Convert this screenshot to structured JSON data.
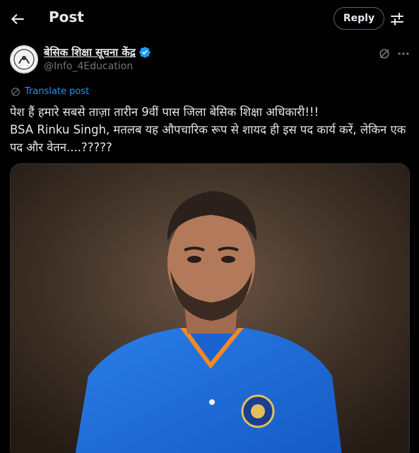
{
  "header": {
    "title": "Post",
    "reply_label": "Reply"
  },
  "post": {
    "author_name": "बेसिक शिक्षा सूचना केंद्र",
    "author_handle": "@Info_4Education",
    "translate_label": "Translate post",
    "text_line1": "पेश हैं हमारे सबसे ताज़ा तारीन 9वीं पास जिला बेसिक शिक्षा अधिकारी!!!",
    "text_line2": "BSA Rinku Singh, मतलब यह औपचारिक रूप से शायद ही इस पद कार्य करें, लेकिन एक पद और वेतन....?????"
  },
  "icons": {
    "back": "arrow-left-icon",
    "filter": "sliders-icon",
    "verified": "verified-badge-icon",
    "grok": "grok-icon",
    "more": "more-icon",
    "translate": "globe-icon"
  },
  "colors": {
    "accent": "#1d9bf0",
    "background": "#000000",
    "text": "#e7e9ea",
    "muted": "#71767b",
    "jersey": "#1e6ee0"
  }
}
